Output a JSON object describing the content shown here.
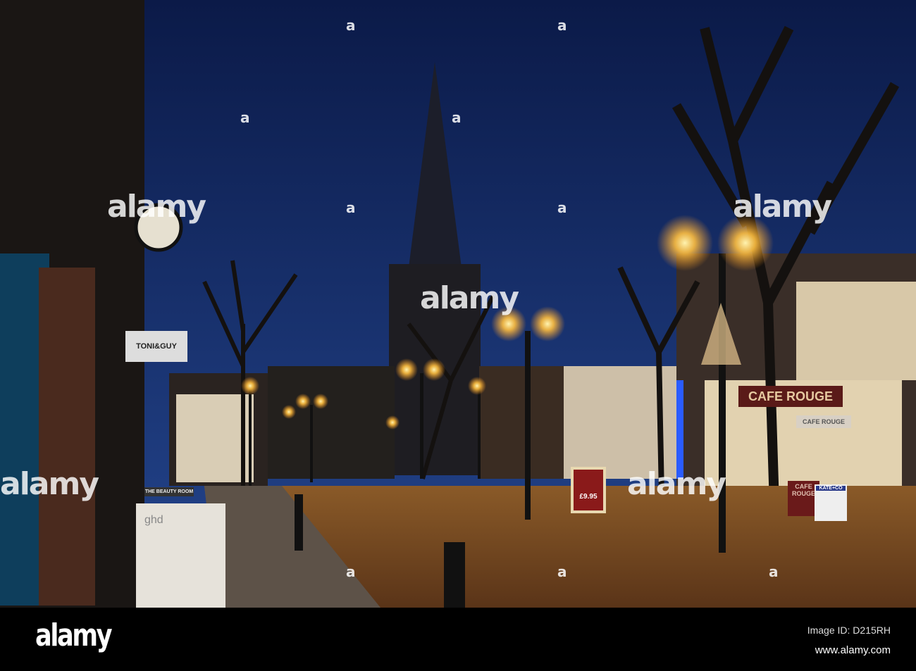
{
  "photo": {
    "signs": {
      "hairdresser": "TONI&GUY",
      "beauty_room": "THE BEAUTY ROOM",
      "ghd_board": "ghd",
      "cafe_fascia": "CAFE ROUGE",
      "cafe_awning": "CAFE ROUGE",
      "cafe_barrier": "CAFE ROUGE",
      "kate_board": "KATE+CO",
      "menu_price": "£9.95"
    },
    "watermark": "alamy",
    "watermark_letter": "a"
  },
  "footer": {
    "logo": "alamy",
    "image_id": "Image ID: D215RH",
    "website": "www.alamy.com"
  },
  "colors": {
    "sky_top": "#0b1a48",
    "sky_bottom": "#21408a",
    "lamp": "#ffc24a",
    "pavement": "#7a4a20"
  }
}
